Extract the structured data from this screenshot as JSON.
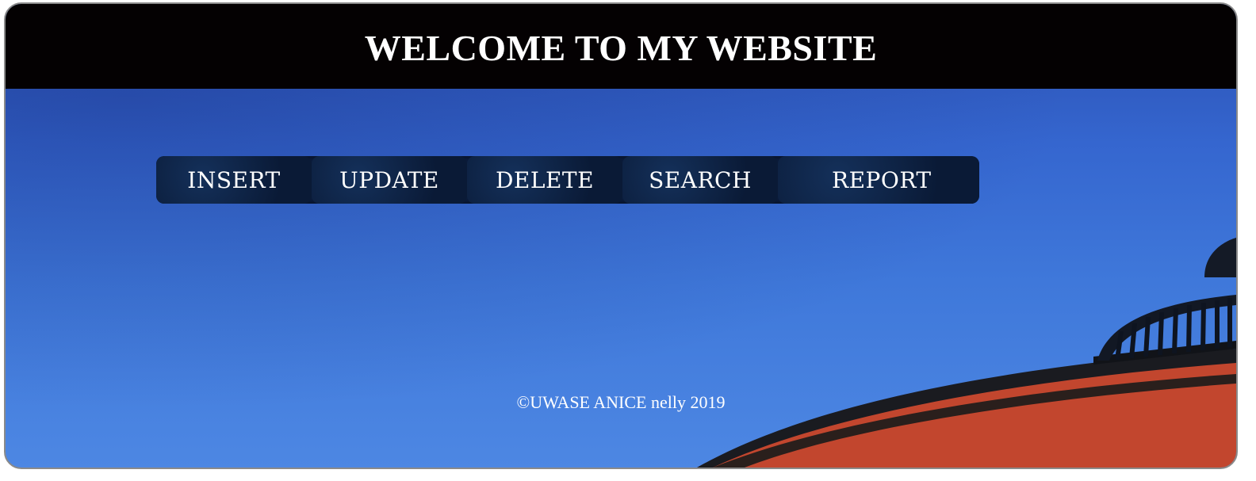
{
  "header": {
    "title": "WELCOME TO MY WEBSITE"
  },
  "nav": {
    "items": [
      {
        "label": "INSERT"
      },
      {
        "label": "UPDATE"
      },
      {
        "label": "DELETE"
      },
      {
        "label": "SEARCH"
      },
      {
        "label": "REPORT"
      }
    ]
  },
  "footer": {
    "text": "©UWASE ANICE nelly 2019"
  },
  "colors": {
    "header_bg": "#040102",
    "sky": "#3f78da",
    "nav_bg": "#0b1c3d"
  }
}
